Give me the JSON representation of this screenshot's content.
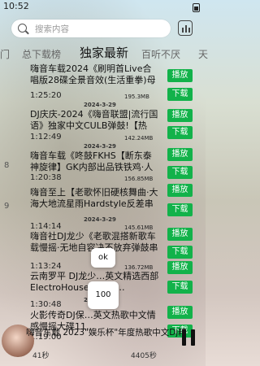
{
  "status_bar": {
    "time": "10:52"
  },
  "search": {
    "placeholder": "搜索内容"
  },
  "tabs": [
    {
      "label": "门"
    },
    {
      "label": "总下载榜"
    },
    {
      "label": "独家最新"
    },
    {
      "label": "百听不厌"
    },
    {
      "label": "天"
    }
  ],
  "songs": [
    {
      "num": "",
      "title": "嗨音车载2024《刷明首Live合唱版28碟全景音效(生活重拳)母带...",
      "date": "",
      "duration": "1:25:20",
      "size": "195.3MB",
      "play_label": "播放",
      "download_label": "下载"
    },
    {
      "num": "",
      "title": "DJ庆庆-2024《嗨音联盟|流行国语》独家中文CULB弹鼓!【热播...",
      "date": "2024-3-29",
      "duration": "",
      "size": "",
      "play_label": "播放",
      "download_label": "下载"
    },
    {
      "num": "",
      "title": "",
      "date": "",
      "duration": "1:12:49",
      "size": "142.24MB",
      "play_label": "",
      "download_label": ""
    },
    {
      "num": "8",
      "title": "嗨音车载《咚鼓FKHS【断东泰神旋律】GK内部出品铁铁鸡·人妖打...",
      "date": "2024-3-29",
      "duration": "1:20:38",
      "size": "156.85MB",
      "play_label": "播放",
      "download_label": "下载"
    },
    {
      "num": "9",
      "title": "嗨音至上【老歌怀旧硬核舞曲·大海大地流星雨Hardstyle反差串烧...",
      "date": "2024-3-29",
      "duration": "1:14:14",
      "size": "145.61MB",
      "play_label": "播放",
      "download_label": "下载"
    },
    {
      "num": "",
      "title": "嗨音社DJ龙少《老歌混搭新歌车载慢摇·无地自容决不放弃弹鼓串烧》",
      "date": "2024-3-29",
      "duration": "1:13:24",
      "size": "136.72MB",
      "play_label": "播放",
      "download_label": "下载"
    },
    {
      "num": "",
      "title": "云南罗平 DJ龙少…英文精选西部ElectroHouse慢…纪…",
      "date": "2024-3-29",
      "duration": "1:30:48",
      "size": "",
      "play_label": "播放",
      "download_label": "下载"
    },
    {
      "num": "",
      "title": "火影传奇DJ保…英文热歌中文情感慢摇大碟11…",
      "date": "2024-3-29",
      "duration": "1:19:00",
      "size": "",
      "play_label": "播放",
      "download_label": "下载"
    }
  ],
  "popups": {
    "ok": "ok",
    "count": "100"
  },
  "now_playing": {
    "title": "嗨音车载 2023\"娱乐杯\"年度热歌中文Dj精选",
    "current": "41秒",
    "total": "4405秒"
  }
}
